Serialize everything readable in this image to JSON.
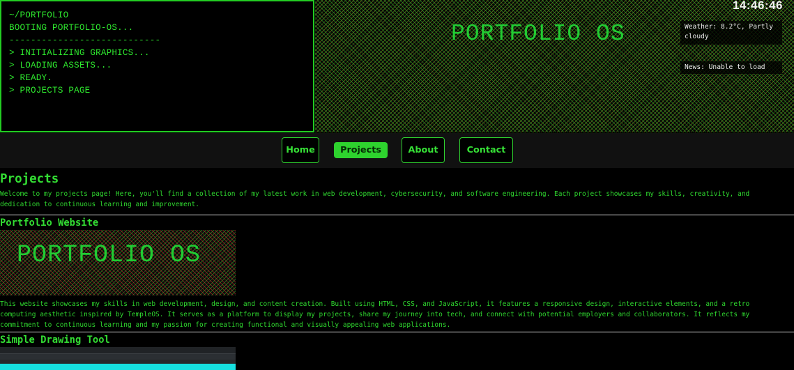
{
  "terminal": {
    "lines": [
      "~/PORTFOLIO",
      "BOOTING PORTFOLIO-OS...",
      "----------------------------",
      "> INITIALIZING GRAPHICS...",
      "> LOADING ASSETS...",
      "> READY.",
      "> PROJECTS PAGE"
    ]
  },
  "banner": {
    "title": "PORTFOLIO OS",
    "clock": "14:46:46",
    "weather": "Weather: 8.2°C, Partly cloudy",
    "news": "News: Unable to load"
  },
  "nav": {
    "items": [
      "Home",
      "Projects",
      "About",
      "Contact"
    ],
    "active": "Projects"
  },
  "page": {
    "title": "Projects",
    "intro": "Welcome to my projects page! Here, you'll find a collection of my latest work in web development, cybersecurity, and software engineering. Each project showcases my skills, creativity, and dedication to continuous learning and improvement."
  },
  "projects": [
    {
      "title": "Portfolio Website",
      "thumb_text": "PORTFOLIO OS",
      "description": "This website showcases my skills in web development, design, and content creation. Built using HTML, CSS, and JavaScript, it features a responsive design, interactive elements, and a retro computing aesthetic inspired by TempleOS. It serves as a platform to display my projects, share my journey into tech, and connect with potential employers and collaborators. It reflects my commitment to continuous learning and my passion for creating functional and visually appealing web applications."
    },
    {
      "title": "Simple Drawing Tool"
    }
  ],
  "colors": {
    "accent": "#33dd33",
    "background": "#000000",
    "nav_bg": "#111111",
    "divider": "#d8d8d8"
  }
}
